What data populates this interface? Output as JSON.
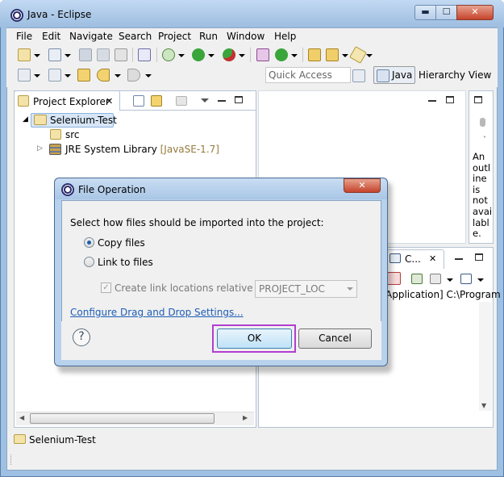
{
  "window": {
    "title": "Java - Eclipse",
    "min": "▬",
    "max": "☐",
    "close": "✕"
  },
  "menubar": [
    "File",
    "Edit",
    "Navigate",
    "Search",
    "Project",
    "Run",
    "Window",
    "Help"
  ],
  "toolbar": {
    "quick_access_placeholder": "Quick Access",
    "perspective_java": "Java",
    "perspective_hierarchy": "Hierarchy View"
  },
  "project_explorer": {
    "tab_label": "Project Explorer",
    "tab_close": "✕",
    "tree": [
      {
        "label": "Selenium-Test",
        "expander": "◢"
      },
      {
        "label": "src"
      },
      {
        "label": "JRE System Library",
        "suffix": "[JavaSE-1.7]",
        "expander": "▷"
      }
    ]
  },
  "outline": {
    "lines": [
      "An",
      "outl",
      "ine",
      "is",
      "not",
      "avai",
      "labl",
      "e."
    ]
  },
  "console": {
    "tab_label": "C...",
    "text": "Application] C:\\Program"
  },
  "dialog": {
    "title": "File Operation",
    "close": "✕",
    "prompt": "Select how files should be imported into the project:",
    "option_copy": "Copy files",
    "option_link": "Link to files",
    "checkbox_label": "Create link locations relative to:",
    "combo_value": "PROJECT_LOC",
    "link_text": "Configure Drag and Drop Settings...",
    "help": "?",
    "ok_label": "OK",
    "cancel_label": "Cancel"
  },
  "status_bar": {
    "text": "Selenium-Test"
  },
  "colors": {
    "accent_focus": "#b13ed1",
    "link": "#1d5db6",
    "frame": "#9ec0e2"
  }
}
